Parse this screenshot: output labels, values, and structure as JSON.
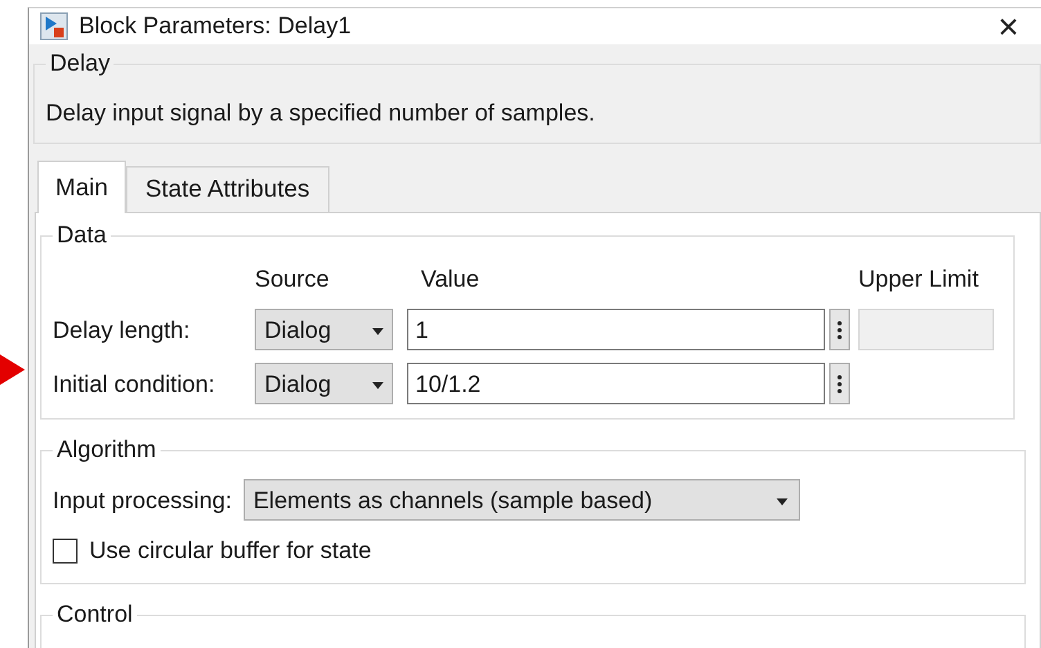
{
  "window": {
    "title": "Block Parameters: Delay1",
    "close": "×"
  },
  "block": {
    "heading": "Delay",
    "description": "Delay input signal by a specified number of samples."
  },
  "tabs": [
    {
      "label": "Main",
      "selected": true
    },
    {
      "label": "State Attributes",
      "selected": false
    }
  ],
  "data_group": {
    "title": "Data",
    "columns": [
      "Source",
      "Value",
      "Upper Limit"
    ],
    "rows": [
      {
        "label": "Delay length:",
        "source": "Dialog",
        "value": "1",
        "upper_limit_field": true
      },
      {
        "label": "Initial condition:",
        "source": "Dialog",
        "value": "10/1.2",
        "upper_limit_field": false
      }
    ]
  },
  "algorithm_group": {
    "title": "Algorithm",
    "input_processing": {
      "label": "Input processing:",
      "value": "Elements as channels (sample based)"
    },
    "checkbox": {
      "label": "Use circular buffer for state",
      "checked": false
    }
  },
  "control_group": {
    "title": "Control"
  }
}
